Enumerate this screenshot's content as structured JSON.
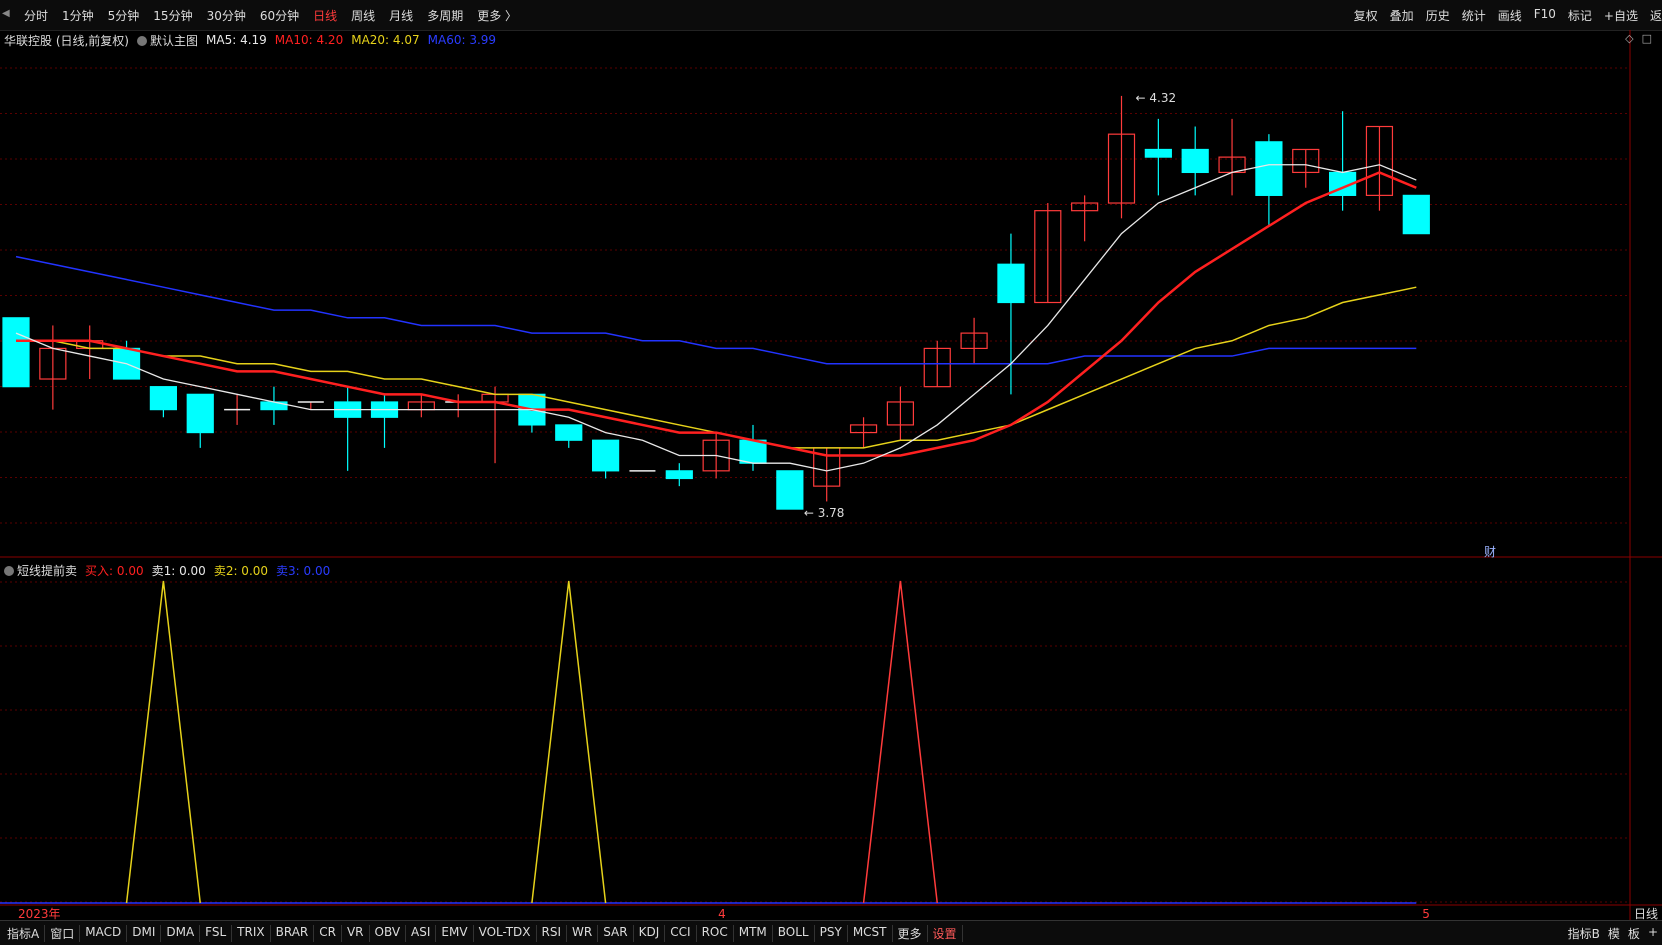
{
  "toolbar": {
    "periods": [
      {
        "label": "分时"
      },
      {
        "label": "1分钟"
      },
      {
        "label": "5分钟"
      },
      {
        "label": "15分钟"
      },
      {
        "label": "30分钟"
      },
      {
        "label": "60分钟"
      },
      {
        "label": "日线",
        "active": true
      },
      {
        "label": "周线"
      },
      {
        "label": "月线"
      },
      {
        "label": "多周期"
      },
      {
        "label": "更多 〉"
      }
    ],
    "tools": [
      "复权",
      "叠加",
      "历史",
      "统计",
      "画线",
      "F10",
      "标记",
      "+自选",
      "返"
    ]
  },
  "main_legend": {
    "stock": "华联控股 (日线,前复权)",
    "template": "默认主图",
    "ma5": "MA5: 4.19",
    "ma10": "MA10: 4.20",
    "ma20": "MA20: 4.07",
    "ma60": "MA60: 3.99"
  },
  "sub_legend": {
    "name": "短线提前卖",
    "buy": "买入: 0.00",
    "sell1": "卖1: 0.00",
    "sell2": "卖2: 0.00",
    "sell3": "卖3: 0.00"
  },
  "annotations": {
    "high": "4.32",
    "low": "3.78",
    "fin_badge": "财"
  },
  "date_labels": {
    "start": "2023年",
    "apr": "4",
    "may": "5",
    "right": "日线"
  },
  "colors": {
    "up": "#ff3b3b",
    "down": "#00ffff",
    "ma5": "#e8e8e8",
    "ma10": "#ff2020",
    "ma20": "#e6d21a",
    "ma60": "#2233ff",
    "bg": "#000000",
    "grid": "#5a0000"
  },
  "chart_data": {
    "type": "candlestick",
    "price_range": [
      3.72,
      4.38
    ],
    "candles": [
      {
        "o": 4.03,
        "h": 4.03,
        "l": 3.94,
        "c": 3.94
      },
      {
        "o": 3.95,
        "h": 4.02,
        "l": 3.91,
        "c": 3.99
      },
      {
        "o": 3.99,
        "h": 4.02,
        "l": 3.95,
        "c": 4.0
      },
      {
        "o": 3.99,
        "h": 4.0,
        "l": 3.95,
        "c": 3.95
      },
      {
        "o": 3.94,
        "h": 3.94,
        "l": 3.9,
        "c": 3.91
      },
      {
        "o": 3.93,
        "h": 3.93,
        "l": 3.86,
        "c": 3.88
      },
      {
        "o": 3.91,
        "h": 3.93,
        "l": 3.89,
        "c": 3.91
      },
      {
        "o": 3.92,
        "h": 3.94,
        "l": 3.89,
        "c": 3.91
      },
      {
        "o": 3.92,
        "h": 3.92,
        "l": 3.91,
        "c": 3.92
      },
      {
        "o": 3.92,
        "h": 3.94,
        "l": 3.83,
        "c": 3.9
      },
      {
        "o": 3.92,
        "h": 3.93,
        "l": 3.86,
        "c": 3.9
      },
      {
        "o": 3.91,
        "h": 3.93,
        "l": 3.9,
        "c": 3.92
      },
      {
        "o": 3.92,
        "h": 3.93,
        "l": 3.9,
        "c": 3.92
      },
      {
        "o": 3.92,
        "h": 3.94,
        "l": 3.84,
        "c": 3.93
      },
      {
        "o": 3.93,
        "h": 3.93,
        "l": 3.88,
        "c": 3.89
      },
      {
        "o": 3.89,
        "h": 3.89,
        "l": 3.86,
        "c": 3.87
      },
      {
        "o": 3.87,
        "h": 3.87,
        "l": 3.82,
        "c": 3.83
      },
      {
        "o": 3.83,
        "h": 3.83,
        "l": 3.83,
        "c": 3.83
      },
      {
        "o": 3.83,
        "h": 3.84,
        "l": 3.81,
        "c": 3.82
      },
      {
        "o": 3.83,
        "h": 3.88,
        "l": 3.82,
        "c": 3.87
      },
      {
        "o": 3.87,
        "h": 3.89,
        "l": 3.83,
        "c": 3.84
      },
      {
        "o": 3.83,
        "h": 3.83,
        "l": 3.78,
        "c": 3.78
      },
      {
        "o": 3.81,
        "h": 3.86,
        "l": 3.79,
        "c": 3.86
      },
      {
        "o": 3.88,
        "h": 3.9,
        "l": 3.86,
        "c": 3.89
      },
      {
        "o": 3.89,
        "h": 3.94,
        "l": 3.87,
        "c": 3.92
      },
      {
        "o": 3.94,
        "h": 4.0,
        "l": 3.94,
        "c": 3.99
      },
      {
        "o": 3.99,
        "h": 4.03,
        "l": 3.97,
        "c": 4.01
      },
      {
        "o": 4.1,
        "h": 4.14,
        "l": 3.93,
        "c": 4.05
      },
      {
        "o": 4.05,
        "h": 4.18,
        "l": 4.05,
        "c": 4.17
      },
      {
        "o": 4.17,
        "h": 4.19,
        "l": 4.13,
        "c": 4.18
      },
      {
        "o": 4.18,
        "h": 4.32,
        "l": 4.16,
        "c": 4.27
      },
      {
        "o": 4.25,
        "h": 4.29,
        "l": 4.19,
        "c": 4.24
      },
      {
        "o": 4.25,
        "h": 4.28,
        "l": 4.19,
        "c": 4.22
      },
      {
        "o": 4.22,
        "h": 4.29,
        "l": 4.19,
        "c": 4.24
      },
      {
        "o": 4.26,
        "h": 4.27,
        "l": 4.15,
        "c": 4.19
      },
      {
        "o": 4.22,
        "h": 4.25,
        "l": 4.2,
        "c": 4.25
      },
      {
        "o": 4.22,
        "h": 4.3,
        "l": 4.17,
        "c": 4.19
      },
      {
        "o": 4.19,
        "h": 4.28,
        "l": 4.17,
        "c": 4.28
      },
      {
        "o": 4.19,
        "h": 4.19,
        "l": 4.14,
        "c": 4.14
      }
    ],
    "ma5": [
      4.01,
      3.99,
      3.98,
      3.97,
      3.95,
      3.94,
      3.93,
      3.92,
      3.91,
      3.91,
      3.91,
      3.91,
      3.91,
      3.91,
      3.91,
      3.9,
      3.88,
      3.87,
      3.85,
      3.85,
      3.84,
      3.84,
      3.83,
      3.84,
      3.86,
      3.89,
      3.93,
      3.97,
      4.02,
      4.08,
      4.14,
      4.18,
      4.2,
      4.22,
      4.23,
      4.23,
      4.22,
      4.23,
      4.21
    ],
    "ma10": [
      4.0,
      4.0,
      4.0,
      3.99,
      3.98,
      3.97,
      3.96,
      3.96,
      3.95,
      3.94,
      3.93,
      3.93,
      3.92,
      3.92,
      3.91,
      3.91,
      3.9,
      3.89,
      3.88,
      3.88,
      3.87,
      3.86,
      3.85,
      3.85,
      3.85,
      3.86,
      3.87,
      3.89,
      3.92,
      3.96,
      4.0,
      4.05,
      4.09,
      4.12,
      4.15,
      4.18,
      4.2,
      4.22,
      4.2
    ],
    "ma20": [
      4.0,
      4.0,
      3.99,
      3.99,
      3.98,
      3.98,
      3.97,
      3.97,
      3.96,
      3.96,
      3.95,
      3.95,
      3.94,
      3.93,
      3.93,
      3.92,
      3.91,
      3.9,
      3.89,
      3.88,
      3.87,
      3.86,
      3.86,
      3.86,
      3.87,
      3.87,
      3.88,
      3.89,
      3.91,
      3.93,
      3.95,
      3.97,
      3.99,
      4.0,
      4.02,
      4.03,
      4.05,
      4.06,
      4.07
    ],
    "ma60": [
      4.11,
      4.1,
      4.09,
      4.08,
      4.07,
      4.06,
      4.05,
      4.04,
      4.04,
      4.03,
      4.03,
      4.02,
      4.02,
      4.02,
      4.01,
      4.01,
      4.01,
      4.0,
      4.0,
      3.99,
      3.99,
      3.98,
      3.97,
      3.97,
      3.97,
      3.97,
      3.97,
      3.97,
      3.97,
      3.98,
      3.98,
      3.98,
      3.98,
      3.98,
      3.99,
      3.99,
      3.99,
      3.99,
      3.99
    ],
    "indicator": {
      "sell2_peaks": [
        4,
        15
      ],
      "buy_peaks": [
        24
      ],
      "range": [
        0,
        1
      ]
    }
  },
  "bottom_tabs": [
    "指标A",
    "窗口",
    "MACD",
    "DMI",
    "DMA",
    "FSL",
    "TRIX",
    "BRAR",
    "CR",
    "VR",
    "OBV",
    "ASI",
    "EMV",
    "VOL-TDX",
    "RSI",
    "WR",
    "SAR",
    "KDJ",
    "CCI",
    "ROC",
    "MTM",
    "BOLL",
    "PSY",
    "MCST",
    "更多",
    "设置"
  ],
  "bottom_right": [
    "指标B",
    "模",
    "板",
    "+"
  ]
}
